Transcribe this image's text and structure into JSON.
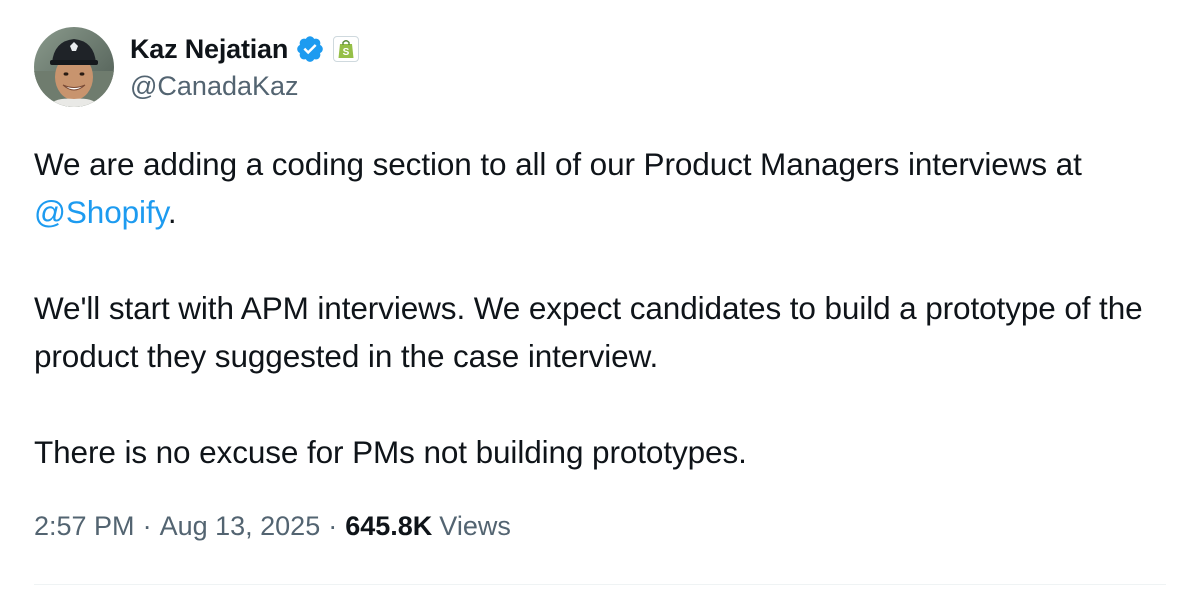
{
  "author": {
    "name": "Kaz Nejatian",
    "handle": "@CanadaKaz",
    "verified_icon": "verified-badge-icon",
    "affiliate_icon": "shopify-bag-icon"
  },
  "tweet": {
    "line1_before": "We are adding a coding section to all of our Product Managers interviews at ",
    "mention": "@Shopify",
    "line1_after": ".",
    "paragraph2": "We'll start with APM interviews. We expect candidates to build a prototype of the product they suggested in the case interview.",
    "paragraph3": "There is no excuse for PMs not building prototypes."
  },
  "meta": {
    "time": "2:57 PM",
    "separator": "·",
    "date": "Aug 13, 2025",
    "views_count": "645.8K",
    "views_label": "Views"
  },
  "colors": {
    "text": "#0f1419",
    "secondary": "#536471",
    "link": "#1d9bf0",
    "verified": "#1d9bf0",
    "shopify_green": "#95bf47"
  }
}
